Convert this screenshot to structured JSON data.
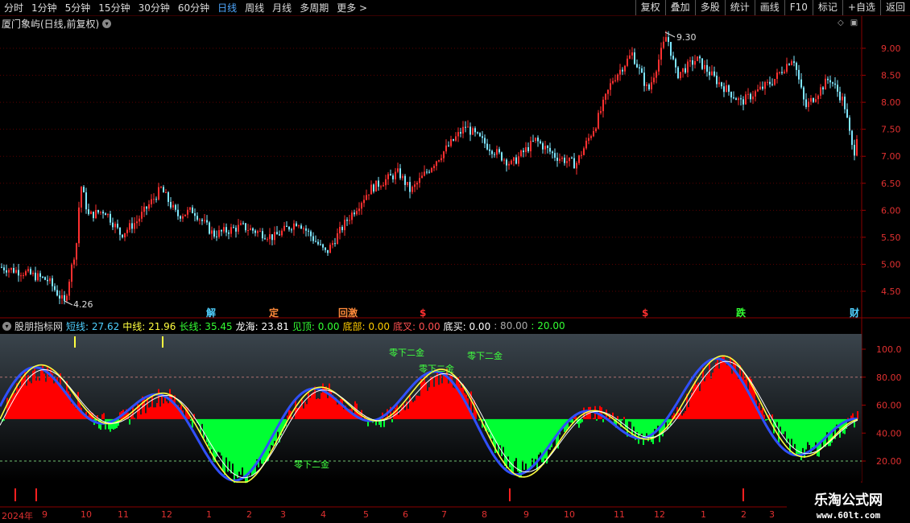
{
  "toolbar": {
    "periods": [
      "分时",
      "1分钟",
      "5分钟",
      "15分钟",
      "30分钟",
      "60分钟",
      "日线",
      "周线",
      "月线",
      "多周期",
      "更多 >"
    ],
    "active": "日线",
    "buttons": [
      "复权",
      "叠加",
      "多股",
      "统计",
      "画线",
      "F10",
      "标记",
      "+自选",
      "返回"
    ]
  },
  "main": {
    "title": "厦门象屿(日线,前复权)",
    "high_label": "9.30",
    "low_label": "4.26",
    "y_ticks": [
      "9.00",
      "8.50",
      "8.00",
      "7.50",
      "7.00",
      "6.50",
      "6.00",
      "5.50",
      "5.00",
      "4.50"
    ],
    "signals": [
      {
        "text": "解",
        "color": "#4fd0ff"
      },
      {
        "text": "定",
        "color": "#ff8a3a"
      },
      {
        "text": "回激",
        "color": "#ff8a3a"
      },
      {
        "text": "$",
        "color": "#ff3030"
      },
      {
        "text": "$",
        "color": "#ff3030"
      },
      {
        "text": "跌",
        "color": "#33ff33"
      },
      {
        "text": "财",
        "color": "#4fd0ff"
      }
    ]
  },
  "indicator": {
    "name": "股朋指标网",
    "fields": [
      {
        "label": "短线:",
        "value": "27.62",
        "color": "#4fd0ff"
      },
      {
        "label": "中线:",
        "value": "21.96",
        "color": "#ffff40"
      },
      {
        "label": "长线:",
        "value": "35.45",
        "color": "#33ff33"
      },
      {
        "label": "龙海:",
        "value": "23.81",
        "color": "#ffffff"
      },
      {
        "label": "见顶:",
        "value": "0.00",
        "color": "#33ff33"
      },
      {
        "label": "底部:",
        "value": "0.00",
        "color": "#ffcc00"
      },
      {
        "label": "底叉:",
        "value": "0.00",
        "color": "#ff5050"
      },
      {
        "label": "底买:",
        "value": "0.00",
        "color": "#ffffff"
      },
      {
        "label": ":",
        "value": "80.00",
        "color": "#aaaaaa"
      },
      {
        "label": ":",
        "value": "20.00",
        "color": "#33ff33"
      }
    ],
    "y_ticks": [
      "100.0",
      "80.00",
      "60.00",
      "40.00",
      "20.00"
    ],
    "annotations": [
      "零下二金",
      "零下二金",
      "零下二金",
      "零下二金"
    ]
  },
  "dates": [
    "2024年",
    "9",
    "10",
    "11",
    "12",
    "1",
    "2",
    "3",
    "4",
    "5",
    "6",
    "7",
    "8",
    "9",
    "10",
    "11",
    "12",
    "1",
    "2",
    "3"
  ],
  "watermark": {
    "line1": "乐淘公式网",
    "line2": "www.60lt.com"
  }
}
